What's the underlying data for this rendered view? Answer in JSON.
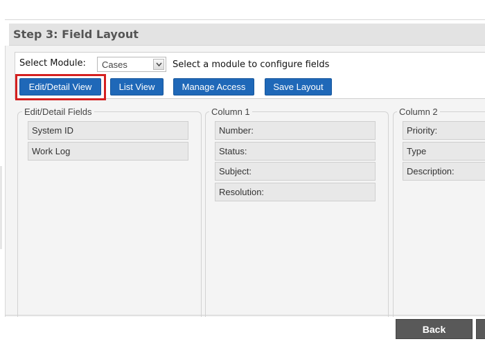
{
  "step": {
    "title": "Step 3: Field Layout"
  },
  "module": {
    "label": "Select Module:",
    "selected": "Cases",
    "hint": "Select a module to configure fields"
  },
  "toolbar": {
    "edit_detail_label": "Edit/Detail View",
    "list_view_label": "List View",
    "manage_access_label": "Manage Access",
    "save_layout_label": "Save Layout"
  },
  "columns": {
    "edit_detail": {
      "legend": "Edit/Detail Fields",
      "fields": [
        "System ID",
        "Work Log"
      ]
    },
    "column1": {
      "legend": "Column 1",
      "fields": [
        "Number:",
        "Status:",
        "Subject:",
        "Resolution:"
      ]
    },
    "column2": {
      "legend": "Column 2",
      "fields": [
        "Priority:",
        "Type",
        "Description:"
      ]
    }
  },
  "footer": {
    "back_label": "Back"
  },
  "colors": {
    "primary_button": "#1f68b8",
    "highlight": "#d41f1f",
    "back_button": "#595959"
  }
}
